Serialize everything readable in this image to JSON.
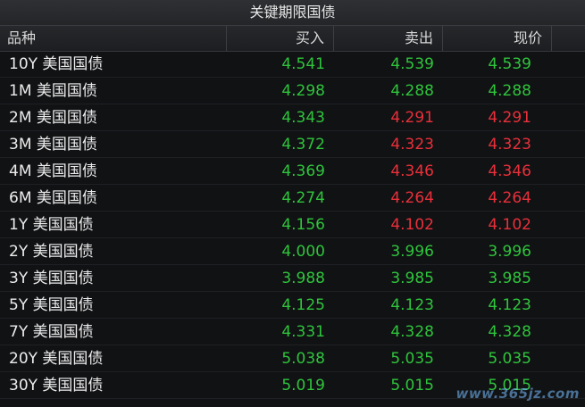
{
  "title": "关键期限国债",
  "columns": {
    "name": "品种",
    "buy": "买入",
    "sell": "卖出",
    "price": "现价"
  },
  "colors": {
    "up": "#2fc43c",
    "down": "#e8303a"
  },
  "rows": [
    {
      "name": "10Y 美国国债",
      "buy": "4.541",
      "sell": "4.539",
      "price": "4.539",
      "sell_dir": "up",
      "price_dir": "up"
    },
    {
      "name": "1M 美国国债",
      "buy": "4.298",
      "sell": "4.288",
      "price": "4.288",
      "sell_dir": "up",
      "price_dir": "up"
    },
    {
      "name": "2M 美国国债",
      "buy": "4.343",
      "sell": "4.291",
      "price": "4.291",
      "sell_dir": "down",
      "price_dir": "down"
    },
    {
      "name": "3M 美国国债",
      "buy": "4.372",
      "sell": "4.323",
      "price": "4.323",
      "sell_dir": "down",
      "price_dir": "down"
    },
    {
      "name": "4M 美国国债",
      "buy": "4.369",
      "sell": "4.346",
      "price": "4.346",
      "sell_dir": "down",
      "price_dir": "down"
    },
    {
      "name": "6M 美国国债",
      "buy": "4.274",
      "sell": "4.264",
      "price": "4.264",
      "sell_dir": "down",
      "price_dir": "down"
    },
    {
      "name": "1Y 美国国债",
      "buy": "4.156",
      "sell": "4.102",
      "price": "4.102",
      "sell_dir": "down",
      "price_dir": "down"
    },
    {
      "name": "2Y 美国国债",
      "buy": "4.000",
      "sell": "3.996",
      "price": "3.996",
      "sell_dir": "up",
      "price_dir": "up"
    },
    {
      "name": "3Y 美国国债",
      "buy": "3.988",
      "sell": "3.985",
      "price": "3.985",
      "sell_dir": "up",
      "price_dir": "up"
    },
    {
      "name": "5Y 美国国债",
      "buy": "4.125",
      "sell": "4.123",
      "price": "4.123",
      "sell_dir": "up",
      "price_dir": "up"
    },
    {
      "name": "7Y 美国国债",
      "buy": "4.331",
      "sell": "4.328",
      "price": "4.328",
      "sell_dir": "up",
      "price_dir": "up"
    },
    {
      "name": "20Y 美国国债",
      "buy": "5.038",
      "sell": "5.035",
      "price": "5.035",
      "sell_dir": "up",
      "price_dir": "up"
    },
    {
      "name": "30Y 美国国债",
      "buy": "5.019",
      "sell": "5.015",
      "price": "5.015",
      "sell_dir": "up",
      "price_dir": "up"
    }
  ],
  "watermark": "www.365jz.com"
}
